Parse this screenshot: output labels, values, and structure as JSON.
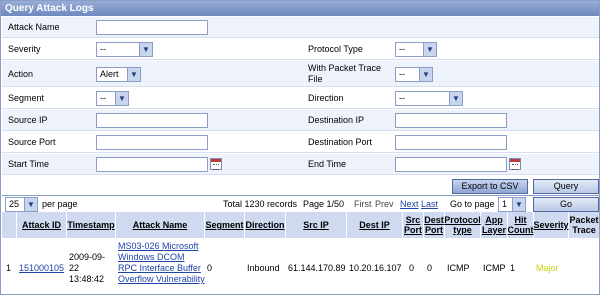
{
  "panel": {
    "title": "Query Attack Logs"
  },
  "form": {
    "attack_name": {
      "label": "Attack Name",
      "value": ""
    },
    "severity": {
      "label": "Severity",
      "value": "--"
    },
    "protocol_type": {
      "label": "Protocol Type",
      "value": "--"
    },
    "action": {
      "label": "Action",
      "value": "Alert"
    },
    "with_packet_trace": {
      "label": "With Packet Trace File",
      "value": "--"
    },
    "segment": {
      "label": "Segment",
      "value": "--"
    },
    "direction": {
      "label": "Direction",
      "value": "--"
    },
    "source_ip": {
      "label": "Source IP",
      "value": ""
    },
    "destination_ip": {
      "label": "Destination IP",
      "value": ""
    },
    "source_port": {
      "label": "Source Port",
      "value": ""
    },
    "destination_port": {
      "label": "Destination Port",
      "value": ""
    },
    "start_time": {
      "label": "Start Time",
      "value": ""
    },
    "end_time": {
      "label": "End Time",
      "value": ""
    }
  },
  "buttons": {
    "export_csv": "Export to CSV",
    "query": "Query",
    "go": "Go"
  },
  "paging": {
    "per_page_value": "25",
    "per_page_label": "per page",
    "total": "Total 1230 records",
    "page": "Page 1/50",
    "first": "First",
    "prev": "Prev",
    "next": "Next",
    "last": "Last",
    "goto_label": "Go to page",
    "goto_value": "1"
  },
  "table": {
    "headers": {
      "attack_id": "Attack ID",
      "timestamp": "Timestamp",
      "attack_name": "Attack Name",
      "segment": "Segment",
      "direction": "Direction",
      "src_ip": "Src IP",
      "dest_ip": "Dest IP",
      "src_port": "Src Port",
      "dest_port": "Dest Port",
      "protocol_type": "Protocol type",
      "app_layer": "App Layer",
      "hit_count": "Hit Count",
      "severity": "Severity",
      "packet_trace": "Packet Trace"
    },
    "rows": [
      {
        "index": "1",
        "attack_id": "151000105",
        "timestamp": "2009-09-22 13:48:42",
        "attack_name": "MS03-026 Microsoft Windows DCOM RPC Interface Buffer Overflow Vulnerability",
        "segment": "0",
        "direction": "Inbound",
        "src_ip": "61.144.170.89",
        "dest_ip": "10.20.16.107",
        "src_port": "0",
        "dest_port": "0",
        "protocol_type": "ICMP",
        "app_layer": "ICMP",
        "hit_count": "1",
        "severity": "Major",
        "packet_trace": ""
      }
    ]
  },
  "colors": {
    "header": "#7b93c8",
    "severity_major": "#cbd010",
    "link": "#1e44a8"
  }
}
